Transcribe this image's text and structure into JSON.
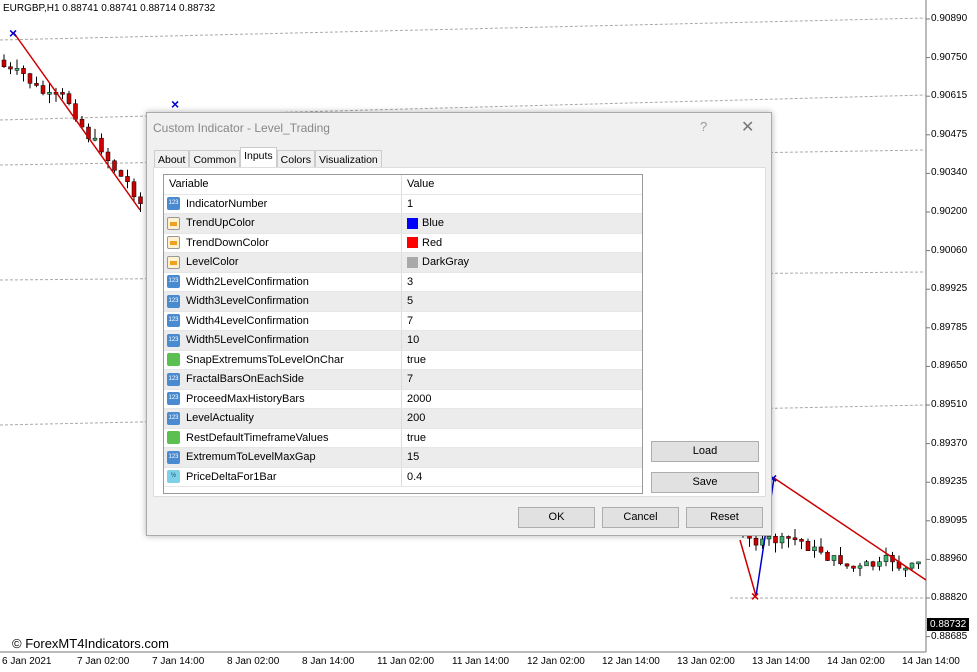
{
  "chart": {
    "symbol_header": "EURGBP,H1  0.88741 0.88741 0.88714 0.88732",
    "price_axis": [
      "0.90890",
      "0.90750",
      "0.90615",
      "0.90475",
      "0.90340",
      "0.90200",
      "0.90060",
      "0.89925",
      "0.89785",
      "0.89650",
      "0.89510",
      "0.89370",
      "0.89235",
      "0.89095",
      "0.88960",
      "0.88820",
      "0.88685"
    ],
    "current_price": "0.88732",
    "time_axis": [
      "6 Jan 2021",
      "7 Jan 02:00",
      "7 Jan 14:00",
      "8 Jan 02:00",
      "8 Jan 14:00",
      "11 Jan 02:00",
      "11 Jan 14:00",
      "12 Jan 02:00",
      "12 Jan 14:00",
      "13 Jan 02:00",
      "13 Jan 14:00",
      "14 Jan 02:00",
      "14 Jan 14:00"
    ],
    "watermark": "© ForexMT4Indicators.com",
    "colors": {
      "bull": "#3cb371",
      "bear": "#cc0000",
      "trend_down": "#cc0000",
      "trend_up": "#0000cc",
      "level": "#a9a9a9"
    }
  },
  "dialog": {
    "title": "Custom Indicator - Level_Trading",
    "help": "?",
    "close": "✕",
    "tabs": [
      {
        "label": "About"
      },
      {
        "label": "Common"
      },
      {
        "label": "Inputs",
        "active": true
      },
      {
        "label": "Colors"
      },
      {
        "label": "Visualization"
      }
    ],
    "table": {
      "headers": [
        "Variable",
        "Value"
      ],
      "rows": [
        {
          "type": "num",
          "variable": "IndicatorNumber",
          "value": "1"
        },
        {
          "type": "clr",
          "variable": "TrendUpColor",
          "value": "Blue",
          "swatch": "#0000ff"
        },
        {
          "type": "clr",
          "variable": "TrendDownColor",
          "value": "Red",
          "swatch": "#ff0000"
        },
        {
          "type": "clr",
          "variable": "LevelColor",
          "value": "DarkGray",
          "swatch": "#a9a9a9"
        },
        {
          "type": "num",
          "variable": "Width2LevelConfirmation",
          "value": "3"
        },
        {
          "type": "num",
          "variable": "Width3LevelConfirmation",
          "value": "5"
        },
        {
          "type": "num",
          "variable": "Width4LevelConfirmation",
          "value": "7"
        },
        {
          "type": "num",
          "variable": "Width5LevelConfirmation",
          "value": "10"
        },
        {
          "type": "bool",
          "variable": "SnapExtremumsToLevelOnChar",
          "value": "true"
        },
        {
          "type": "num",
          "variable": "FractalBarsOnEachSide",
          "value": "7"
        },
        {
          "type": "num",
          "variable": "ProceedMaxHistoryBars",
          "value": "2000"
        },
        {
          "type": "num",
          "variable": "LevelActuality",
          "value": "200"
        },
        {
          "type": "bool",
          "variable": "RestDefaultTimeframeValues",
          "value": "true"
        },
        {
          "type": "num",
          "variable": "ExtremumToLevelMaxGap",
          "value": "15"
        },
        {
          "type": "dbl",
          "variable": "PriceDeltaFor1Bar",
          "value": "0.4"
        }
      ]
    },
    "buttons": {
      "load": "Load",
      "save": "Save",
      "ok": "OK",
      "cancel": "Cancel",
      "reset": "Reset"
    }
  }
}
